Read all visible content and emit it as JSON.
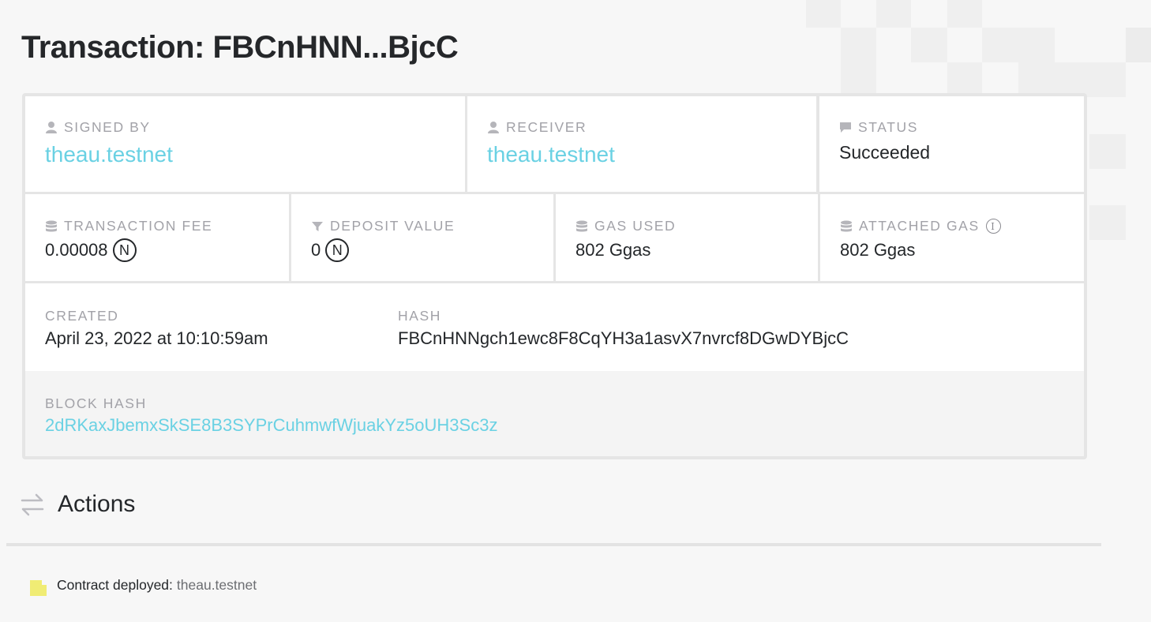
{
  "page": {
    "title": "Transaction: FBCnHNN...BjcC"
  },
  "transaction": {
    "signed_by_label": "SIGNED BY",
    "signed_by": "theau.testnet",
    "receiver_label": "RECEIVER",
    "receiver": "theau.testnet",
    "status_label": "STATUS",
    "status": "Succeeded",
    "fee_label": "TRANSACTION FEE",
    "fee": "0.00008",
    "deposit_label": "DEPOSIT VALUE",
    "deposit": "0",
    "near_symbol": "N",
    "gas_used_label": "GAS USED",
    "gas_used": "802 Ggas",
    "attached_gas_label": "ATTACHED GAS",
    "attached_gas": "802 Ggas",
    "info_symbol": "i",
    "created_label": "CREATED",
    "created": "April 23, 2022 at 10:10:59am",
    "hash_label": "HASH",
    "hash": "FBCnHNNgch1ewc8F8CqYH3a1asvX7nvrcf8DGwDYBjcC",
    "block_hash_label": "BLOCK HASH",
    "block_hash": "2dRKaxJbemxSkSE8B3SYPrCuhmwfWjuakYz5oUH3Sc3z"
  },
  "actions": {
    "title": "Actions",
    "items": [
      {
        "text": "Contract deployed:",
        "account": "theau.testnet"
      }
    ]
  },
  "colors": {
    "link": "#6ad1e3",
    "label": "#a2a2a8",
    "action_icon": "#f0ec74"
  }
}
